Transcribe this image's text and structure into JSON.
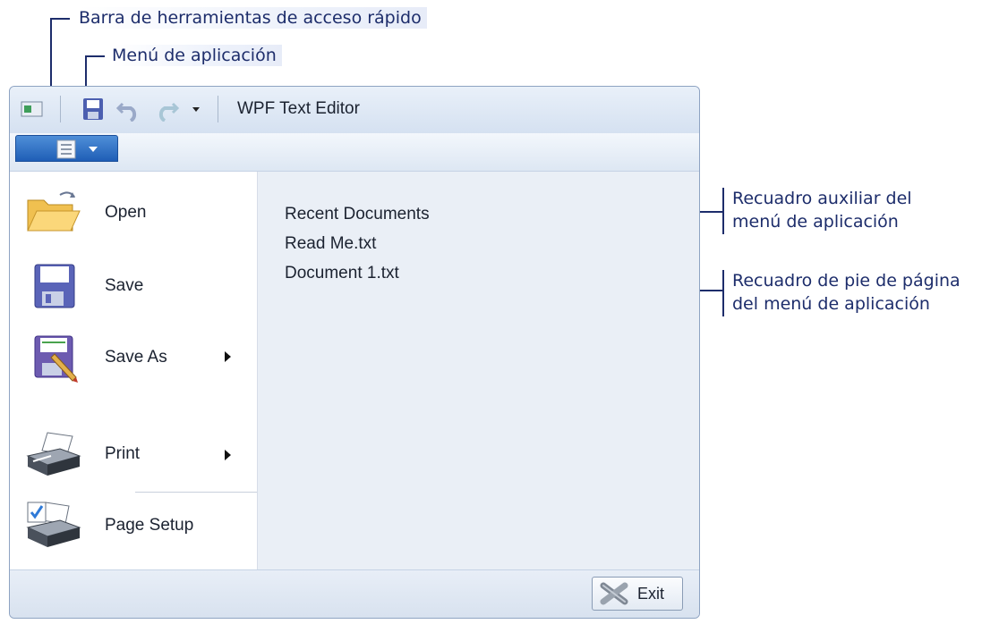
{
  "callouts": {
    "quick_access_toolbar": "Barra de herramientas de acceso rápido",
    "application_menu": "Menú de aplicación",
    "auxiliary_pane_line1": "Recuadro auxiliar del",
    "auxiliary_pane_line2": "menú de aplicación",
    "footer_pane_line1": "Recuadro de pie de página",
    "footer_pane_line2": "del menú de aplicación"
  },
  "window": {
    "title": "WPF Text Editor"
  },
  "menu": {
    "items": [
      {
        "label": "Open",
        "icon": "open-folder-icon",
        "has_submenu": false
      },
      {
        "label": "Save",
        "icon": "save-floppy-icon",
        "has_submenu": false
      },
      {
        "label": "Save As",
        "icon": "save-as-icon",
        "has_submenu": true
      },
      {
        "label": "Print",
        "icon": "printer-icon",
        "has_submenu": true
      },
      {
        "label": "Page Setup",
        "icon": "page-setup-icon",
        "has_submenu": false
      }
    ]
  },
  "recent": {
    "header": "Recent Documents",
    "documents": [
      "Read Me.txt",
      "Document 1.txt"
    ]
  },
  "footer": {
    "exit_label": "Exit"
  },
  "colors": {
    "callout_text": "#1d2d6b",
    "app_button": "#2a6bc3",
    "window_border": "#8ea3c2"
  }
}
